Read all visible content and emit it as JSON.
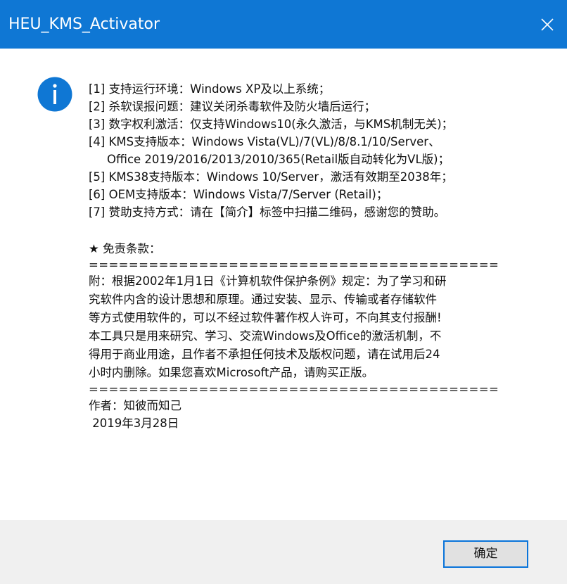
{
  "window": {
    "title": "HEU_KMS_Activator",
    "titlebar_color": "#0f77d4"
  },
  "icons": {
    "info": "info-icon",
    "close": "close-icon"
  },
  "message": {
    "lines": [
      "[1] 支持运行环境：Windows XP及以上系统；",
      "[2] 杀软误报问题：建议关闭杀毒软件及防火墙后运行；",
      "[3] 数字权利激活：仅支持Windows10(永久激活，与KMS机制无关)；",
      "[4] KMS支持版本：Windows Vista(VL)/7(VL)/8/8.1/10/Server、",
      "Office 2019/2016/2013/2010/365(Retail版自动转化为VL版)；",
      "[5] KMS38支持版本：Windows 10/Server，激活有效期至2038年；",
      "[6] OEM支持版本：Windows Vista/7/Server (Retail)；",
      "[7] 赞助支持方式：请在【简介】标签中扫描二维码，感谢您的赞助。"
    ],
    "disclaimer_heading": "★ 免责条款：",
    "separator": "=========================================",
    "disclaimer_lines": [
      "附：根据2002年1月1日《计算机软件保护条例》规定：为了学习和研",
      "究软件内含的设计思想和原理。通过安装、显示、传输或者存储软件",
      "等方式使用软件的，可以不经过软件著作权人许可，不向其支付报酬!",
      "本工具只是用来研究、学习、交流Windows及Office的激活机制，不",
      "得用于商业用途，且作者不承担任何技术及版权问题，请在试用后24",
      "小时内删除。如果您喜欢Microsoft产品，请购买正版。"
    ],
    "author": "作者：知彼而知己",
    "date": " 2019年3月28日"
  },
  "footer": {
    "ok_label": "确定",
    "accent_color": "#0a74da"
  }
}
